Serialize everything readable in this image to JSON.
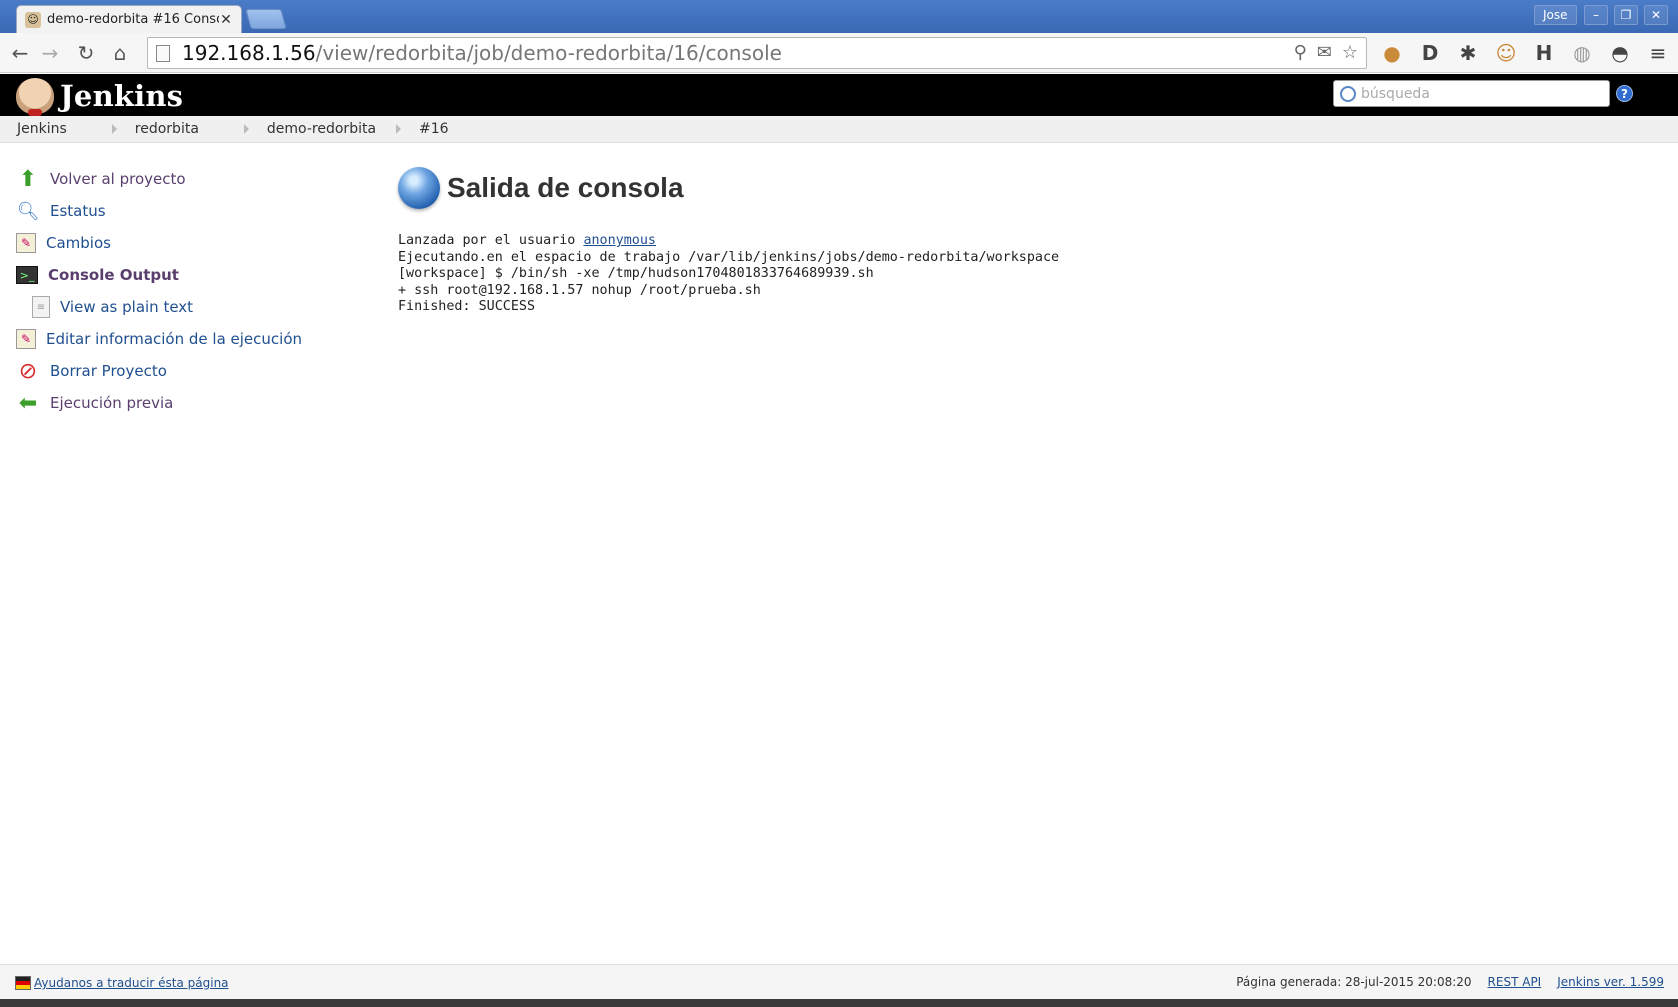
{
  "browser": {
    "tab_title": "demo-redorbita #16 Conso",
    "user_label": "Jose",
    "window_buttons": [
      "–",
      "❐",
      "✕"
    ],
    "url_host": "192.168.1.56",
    "url_path": "/view/redorbita/job/demo-redorbita/16/console"
  },
  "header": {
    "brand": "Jenkins",
    "search_placeholder": "búsqueda",
    "help_label": "?"
  },
  "breadcrumb": [
    "Jenkins",
    "redorbita",
    "demo-redorbita",
    "#16"
  ],
  "sidebar": {
    "items": [
      {
        "label": "Volver al proyecto",
        "icon": "up-arrow-icon"
      },
      {
        "label": "Estatus",
        "icon": "magnifier-icon"
      },
      {
        "label": "Cambios",
        "icon": "notepad-icon"
      },
      {
        "label": "Console Output",
        "icon": "terminal-icon"
      },
      {
        "label": "View as plain text",
        "icon": "document-icon"
      },
      {
        "label": "Editar información de la ejecución",
        "icon": "notepad-icon"
      },
      {
        "label": "Borrar Proyecto",
        "icon": "no-entry-icon"
      },
      {
        "label": "Ejecución previa",
        "icon": "left-arrow-icon"
      }
    ]
  },
  "main": {
    "title": "Salida de consola",
    "console": {
      "line1_prefix": "Lanzada por el usuario ",
      "line1_user": "anonymous",
      "rest": "Ejecutando.en el espacio de trabajo /var/lib/jenkins/jobs/demo-redorbita/workspace\n[workspace] $ /bin/sh -xe /tmp/hudson1704801833764689939.sh\n+ ssh root@192.168.1.57 nohup /root/prueba.sh\nFinished: SUCCESS"
    }
  },
  "footer": {
    "translate_link": "Ayudanos a traducir ésta página",
    "generated": "Página generada: 28-jul-2015 20:08:20",
    "rest_api": "REST API",
    "version": "Jenkins ver. 1.599"
  },
  "colors": {
    "link": "#1f4f8f",
    "visited": "#5a3f6e",
    "header_bg": "#000000"
  }
}
